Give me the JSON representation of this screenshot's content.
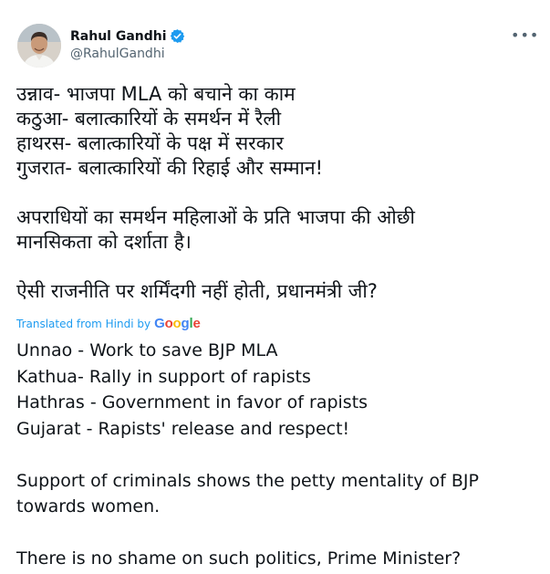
{
  "author": {
    "display_name": "Rahul Gandhi",
    "handle": "@RahulGandhi",
    "verified_icon": "verified-badge-icon",
    "avatar_icon": "avatar-portrait"
  },
  "menu": {
    "more_label": "•••"
  },
  "original": {
    "lines": [
      "उन्नाव- भाजपा MLA को बचाने का काम",
      "कठुआ- बलात्कारियों के समर्थन में रैली",
      "हाथरस- बलात्कारियों के पक्ष में सरकार",
      "गुजरात- बलात्कारियों की रिहाई और सम्मान!",
      "",
      "अपराधियों का समर्थन महिलाओं के प्रति भाजपा की ओछी",
      "मानसिकता को दर्शाता है।",
      "",
      "ऐसी राजनीति पर शर्मिंदगी नहीं होती, प्रधानमंत्री जी?"
    ]
  },
  "translation": {
    "label": "Translated from Hindi by",
    "provider": "Google",
    "lines": [
      "Unnao - Work to save BJP MLA",
      "Kathua- Rally in support of rapists",
      "Hathras - Government in favor of rapists",
      "Gujarat - Rapists' release and respect!",
      "",
      "Support of criminals shows the petty mentality of BJP",
      "towards women.",
      "",
      "There is no shame on such politics, Prime Minister?"
    ]
  },
  "colors": {
    "text": "#0f1419",
    "secondary": "#536471",
    "link": "#1d9bf0",
    "google": [
      "#4285F4",
      "#EA4335",
      "#FBBC05",
      "#4285F4",
      "#34A853",
      "#EA4335"
    ]
  }
}
